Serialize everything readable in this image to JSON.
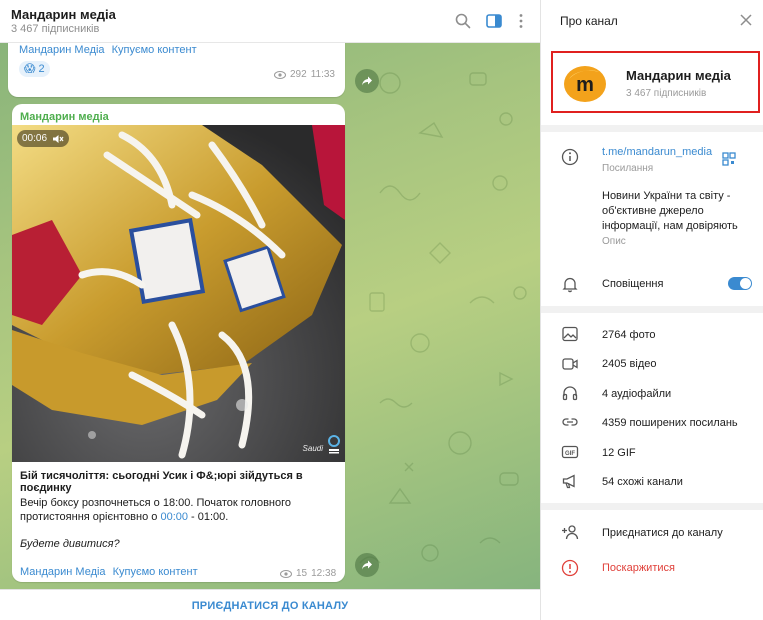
{
  "chat": {
    "title": "Мандарин медіа",
    "subtitle": "3 467 підписників",
    "header_icons": [
      "search-icon",
      "sidebar-toggle-icon",
      "more-vertical-icon"
    ]
  },
  "messages": [
    {
      "links": [
        "Мандарин Медіа",
        "Купуємо контент"
      ],
      "reaction_emoji": "😱",
      "reaction_count": "2",
      "views": "292",
      "time": "11:33"
    },
    {
      "sender": "Мандарин медіа",
      "video_time": "00:06",
      "title": "Бій тисячоліття: сьогодні Усик і Ф&;юрі зійдуться в поєдинку",
      "body_prefix": "Вечір боксу розпочнеться о 18:00. Початок головного протистояння орієнтовно о ",
      "body_link": "00:00",
      "body_suffix": " - 01:00.",
      "question": "Будете дивитися?",
      "links": [
        "Мандарин Медіа",
        "Купуємо контент"
      ],
      "views": "15",
      "time": "12:38"
    }
  ],
  "join_label": "ПРИЄДНАТИСЯ ДО КАНАЛУ",
  "info": {
    "title": "Про канал",
    "name": "Мандарин медіа",
    "subscribers": "3 467 підписників",
    "link": "t.me/mandarun_media",
    "link_label": "Посилання",
    "description": "Новини України та світу - об'єктивне джерело інформації, нам довіряють",
    "description_label": "Опис",
    "notifications_label": "Сповіщення",
    "notifications_on": true,
    "stats": [
      "2764 фото",
      "2405 відео",
      "4 аудіофайли",
      "4359 поширених посилань",
      "12 GIF",
      "54 схожі канали"
    ],
    "join": "Приєднатися до каналу",
    "report": "Поскаржитися"
  },
  "colors": {
    "accent": "#3a8ad0",
    "sender_green": "#4fae4e",
    "highlight_red": "#e0201f",
    "report_red": "#e0403a"
  }
}
